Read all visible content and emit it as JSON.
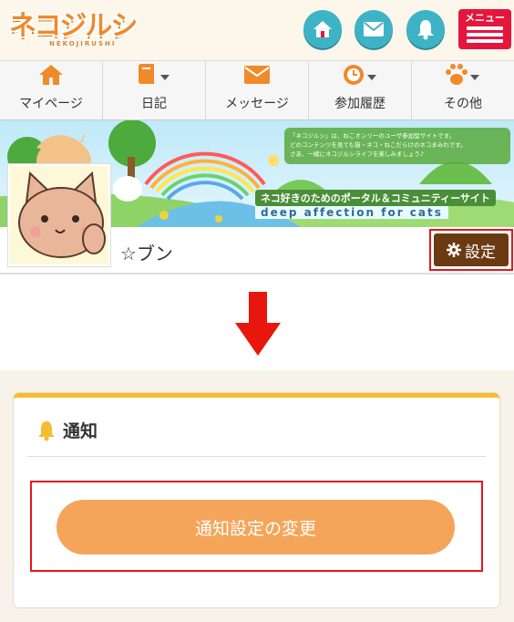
{
  "header": {
    "logo_text": "ネコジルシ",
    "logo_sub": "NEKOJIRUSHI",
    "menu_label": "メニュー",
    "icons": [
      "home-icon",
      "mail-icon",
      "bell-icon"
    ]
  },
  "nav": {
    "items": [
      {
        "label": "マイページ",
        "icon": "house-icon"
      },
      {
        "label": "日記",
        "icon": "diary-icon"
      },
      {
        "label": "メッセージ",
        "icon": "envelope-icon"
      },
      {
        "label": "参加履歴",
        "icon": "clock-icon"
      },
      {
        "label": "その他",
        "icon": "paw-icon"
      }
    ]
  },
  "banner": {
    "caption_line1": "「ネコジルシ」は、ねこオンリーのユーザ参加型サイトです。",
    "caption_line2": "どのコンテンツを見ても猫・ネコ・ねこだらけのネコまみれです。",
    "caption_line3": "さあ、一緒にネコジルシライフを楽しみましょう♪",
    "tagline": "ネコ好きのためのポータル＆コミュニティーサイト",
    "tagline_en": "deep affection for cats"
  },
  "profile": {
    "username": "☆ブン",
    "settings_label": "設定"
  },
  "notification_card": {
    "title": "通知",
    "button_label": "通知設定の変更"
  },
  "colors": {
    "accent_orange": "#f5a55a",
    "highlight_red": "#e5161d",
    "settings_brown": "#6b3a13",
    "icon_teal": "#3fb3c6",
    "menu_red": "#e5163d"
  }
}
